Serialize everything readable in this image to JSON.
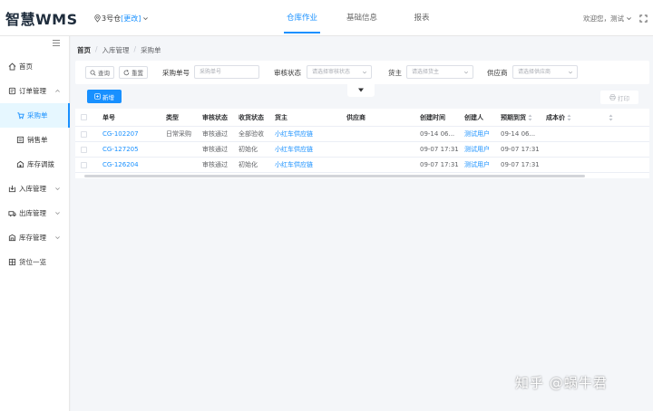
{
  "app": {
    "logo": "智慧WMS",
    "warehouse": "3号仓",
    "warehouse_change": "[更改]",
    "top_tabs": [
      {
        "label": "仓库作业",
        "active": true
      },
      {
        "label": "基础信息",
        "active": false
      },
      {
        "label": "报表",
        "active": false
      }
    ],
    "user_text": "欢迎您，测试",
    "accent_color": "#1890ff"
  },
  "sidebar": {
    "items": [
      {
        "label": "首页",
        "icon": "home-icon"
      },
      {
        "label": "订单管理",
        "icon": "order-icon",
        "arrow": "up"
      },
      {
        "label": "采购单",
        "icon": "purchase-icon",
        "active": true
      },
      {
        "label": "销售单",
        "icon": "sales-icon"
      },
      {
        "label": "库存调拨",
        "icon": "transfer-icon"
      },
      {
        "label": "入库管理",
        "icon": "inbound-icon",
        "arrow": "down"
      },
      {
        "label": "出库管理",
        "icon": "outbound-icon",
        "arrow": "down"
      },
      {
        "label": "库存管理",
        "icon": "inventory-icon",
        "arrow": "down"
      },
      {
        "label": "货位一览",
        "icon": "location-icon"
      }
    ]
  },
  "breadcrumb": [
    "首页",
    "入库管理",
    "采购单"
  ],
  "filters": {
    "query_label": "查询",
    "reset_label": "重置",
    "po_label": "采购单号",
    "po_placeholder": "采购单号",
    "audit_label": "审核状态",
    "audit_placeholder": "请选择审核状态",
    "owner_label": "货主",
    "owner_placeholder": "请选择货主",
    "supplier_label": "供应商",
    "supplier_placeholder": "请选择供应商"
  },
  "toolbar": {
    "add_label": "新增",
    "print_label": "打印"
  },
  "table": {
    "columns": [
      "单号",
      "类型",
      "审核状态",
      "收货状态",
      "货主",
      "供应商",
      "创建时间",
      "创建人",
      "预期到货",
      "成本价"
    ],
    "rows": [
      [
        "CG-102207",
        "日常采购",
        "审核通过",
        "全部验收",
        "小红车供应链",
        "",
        "09-14 06...",
        "测试用户",
        "09-14 06...",
        ""
      ],
      [
        "CG-127205",
        "",
        "审核通过",
        "初始化",
        "小红车供应链",
        "",
        "09-07 17:31",
        "测试用户",
        "09-07 17:31",
        ""
      ],
      [
        "CG-126204",
        "",
        "审核通过",
        "初始化",
        "小红车供应链",
        "",
        "09-07 17:31",
        "测试用户",
        "09-07 17:31",
        ""
      ]
    ]
  },
  "watermark": "知乎 @蜗牛君"
}
